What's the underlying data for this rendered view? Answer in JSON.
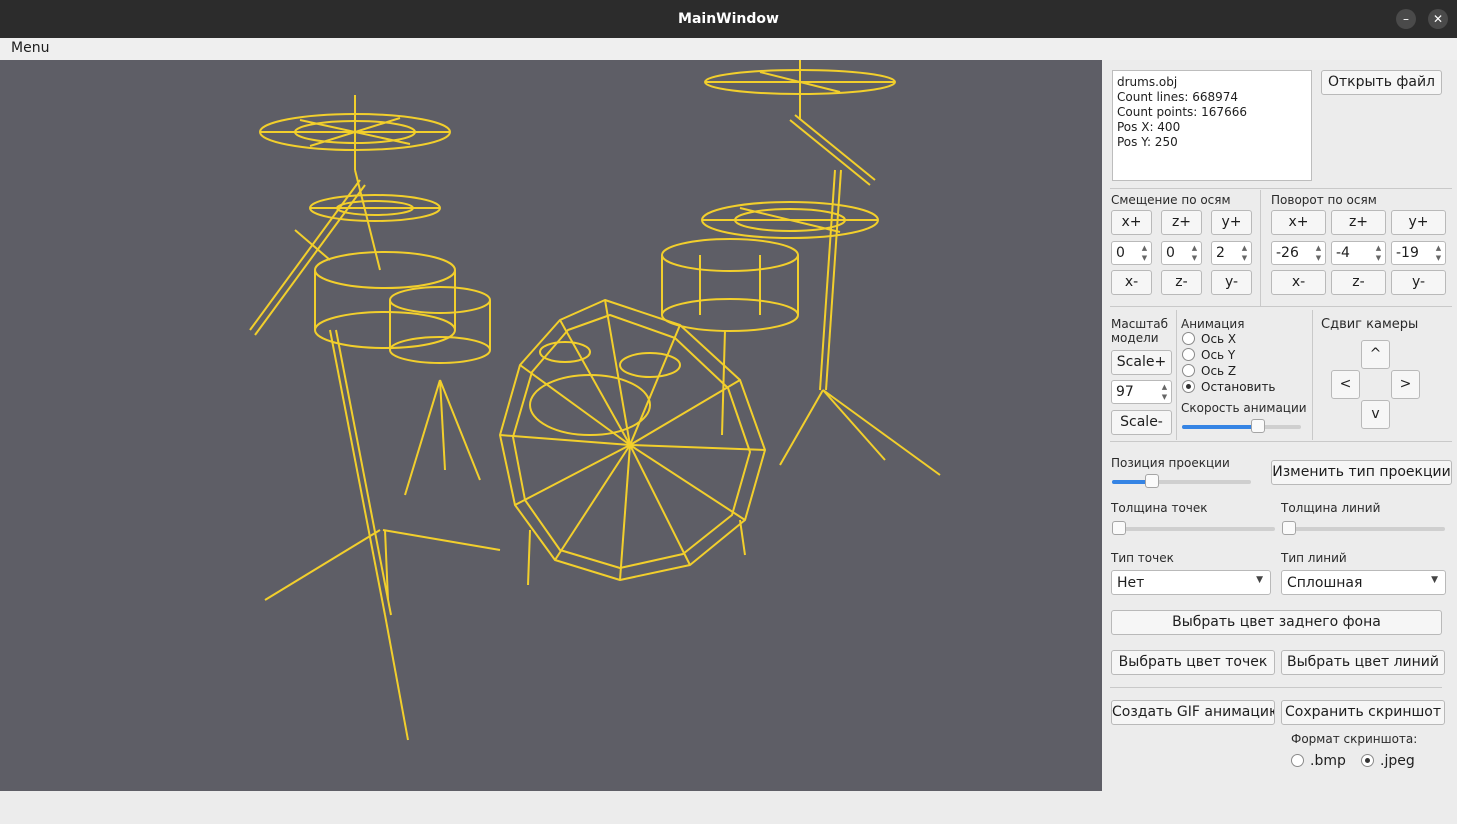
{
  "window": {
    "title": "MainWindow",
    "minimize": "–",
    "close": "✕"
  },
  "menu": {
    "label": "Menu"
  },
  "colors": {
    "background": "#5e5e66",
    "lines": "#f2cf2c",
    "accent": "#3584e4"
  },
  "info": {
    "file": "drums.obj",
    "lines": "Count lines: 668974",
    "points": "Count points: 167666",
    "posx": "Pos X: 400",
    "posy": "Pos Y: 250"
  },
  "open_file": "Открыть файл",
  "translate": {
    "title": "Смещение по осям",
    "plus": [
      "x+",
      "z+",
      "y+"
    ],
    "values": [
      "0",
      "0",
      "2"
    ],
    "minus": [
      "x-",
      "z-",
      "y-"
    ]
  },
  "rotate": {
    "title": "Поворот по осям",
    "plus": [
      "x+",
      "z+",
      "y+"
    ],
    "values": [
      "-26",
      "-4",
      "-19"
    ],
    "minus": [
      "x-",
      "z-",
      "y-"
    ]
  },
  "scale": {
    "title1": "Масштаб",
    "title2": "модели",
    "plus": "Scale+",
    "value": "97",
    "minus": "Scale-"
  },
  "animation": {
    "title": "Анимация",
    "options": [
      "Ось X",
      "Ось Y",
      "Ось Z",
      "Остановить"
    ],
    "selected": 3,
    "speed_label": "Скорость анимации",
    "speed_fraction": 0.66
  },
  "camera": {
    "title": "Сдвиг камеры",
    "up": "^",
    "left": "<",
    "right": ">",
    "down": "v"
  },
  "projection": {
    "label": "Позиция проекции",
    "fraction": 0.26,
    "change": "Изменить тип проекции"
  },
  "point_size": {
    "label": "Толщина точек",
    "fraction": 0.0
  },
  "line_width": {
    "label": "Толщина линий",
    "fraction": 0.0
  },
  "point_type": {
    "label": "Тип точек",
    "value": "Нет"
  },
  "line_type": {
    "label": "Тип линий",
    "value": "Сплошная"
  },
  "buttons": {
    "bg_color": "Выбрать цвет заднего фона",
    "point_color": "Выбрать цвет точек",
    "line_color": "Выбрать цвет линий",
    "gif": "Создать GIF анимацию",
    "screenshot": "Сохранить скриншот"
  },
  "screenshot_format": {
    "label": "Формат скриншота:",
    "options": [
      ".bmp",
      ".jpeg"
    ],
    "selected": 1
  },
  "icons": {
    "minimize": "minimize-icon",
    "close": "close-icon",
    "combo_arrow": "chevron-down-icon"
  }
}
